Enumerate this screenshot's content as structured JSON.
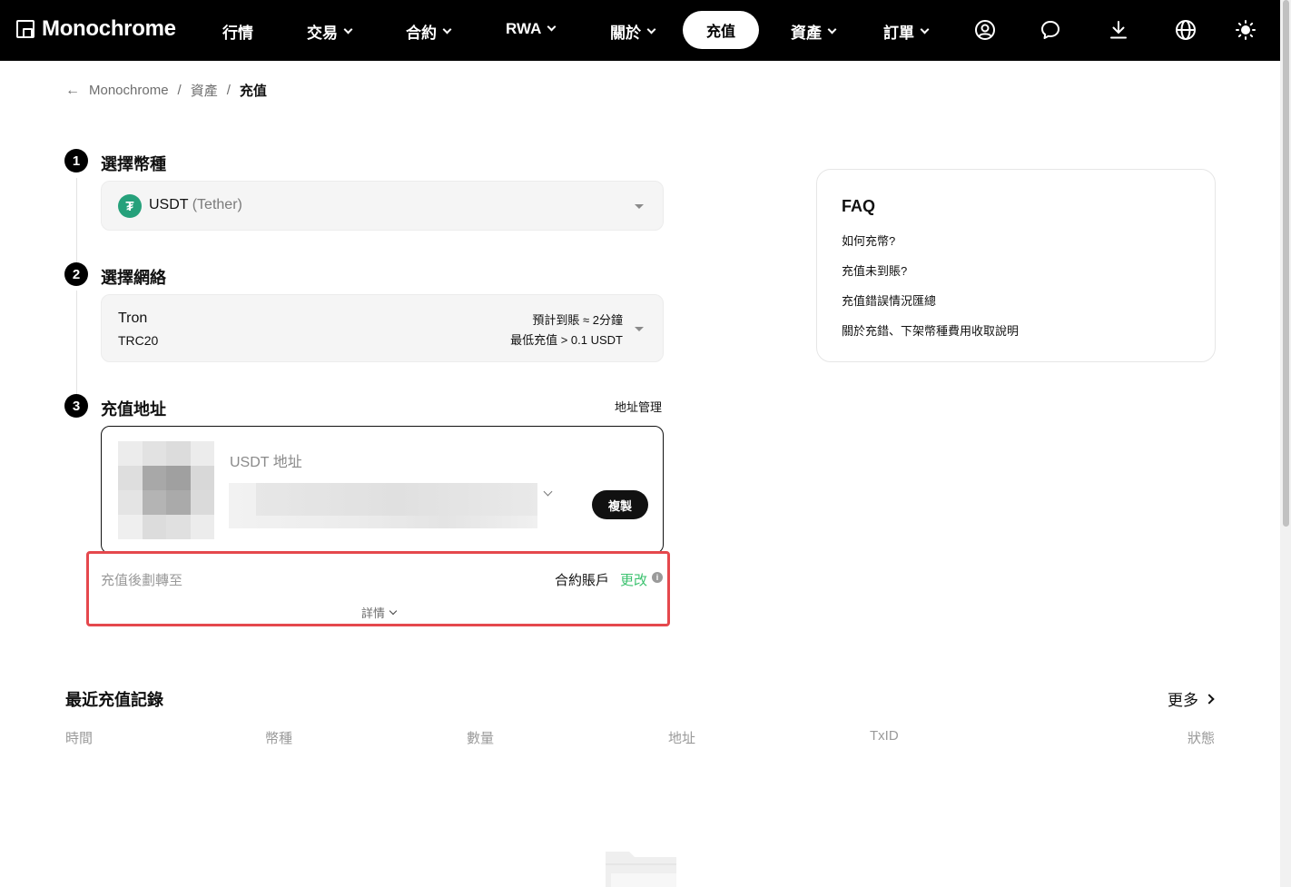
{
  "brand": {
    "name": "Monochrome"
  },
  "nav": {
    "items": [
      {
        "label": "行情",
        "has_dropdown": false
      },
      {
        "label": "交易",
        "has_dropdown": true
      },
      {
        "label": "合約",
        "has_dropdown": true
      },
      {
        "label": "RWA",
        "has_dropdown": true
      },
      {
        "label": "關於",
        "has_dropdown": true
      },
      {
        "label": "資產",
        "has_dropdown": true
      },
      {
        "label": "訂單",
        "has_dropdown": true
      }
    ],
    "active_label": "充值",
    "icons": [
      "user-icon",
      "chat-icon",
      "download-icon",
      "globe-icon",
      "sun-icon"
    ]
  },
  "breadcrumb": {
    "home": "Monochrome",
    "section": "資產",
    "current": "充值",
    "sep": "/"
  },
  "steps": {
    "step1": {
      "num": "1",
      "title": "選擇幣種",
      "coin_symbol": "USDT",
      "coin_name": "(Tether)",
      "coin_glyph": "₮"
    },
    "step2": {
      "num": "2",
      "title": "選擇網絡",
      "network": "Tron",
      "protocol": "TRC20",
      "eta": "預計到賬 ≈ 2分鐘",
      "min_deposit": "最低充值 > 0.1 USDT"
    },
    "step3": {
      "num": "3",
      "title": "充值地址",
      "manage_link": "地址管理",
      "address_label": "USDT 地址",
      "copy_label": "複製"
    }
  },
  "transfer": {
    "label": "充值後劃轉至",
    "account": "合約賬戶",
    "change_label": "更改",
    "details_label": "詳情"
  },
  "faq": {
    "title": "FAQ",
    "items": [
      "如何充幣?",
      "充值未到賬?",
      "充值錯誤情況匯總",
      "關於充錯、下架幣種費用收取說明"
    ]
  },
  "records": {
    "title": "最近充值記錄",
    "more_label": "更多",
    "columns": [
      "時間",
      "幣種",
      "數量",
      "地址",
      "TxID",
      "狀態"
    ]
  },
  "colors": {
    "accent_green": "#3cc26f",
    "highlight_red": "#e5484d",
    "tether_green": "#26a17b"
  }
}
